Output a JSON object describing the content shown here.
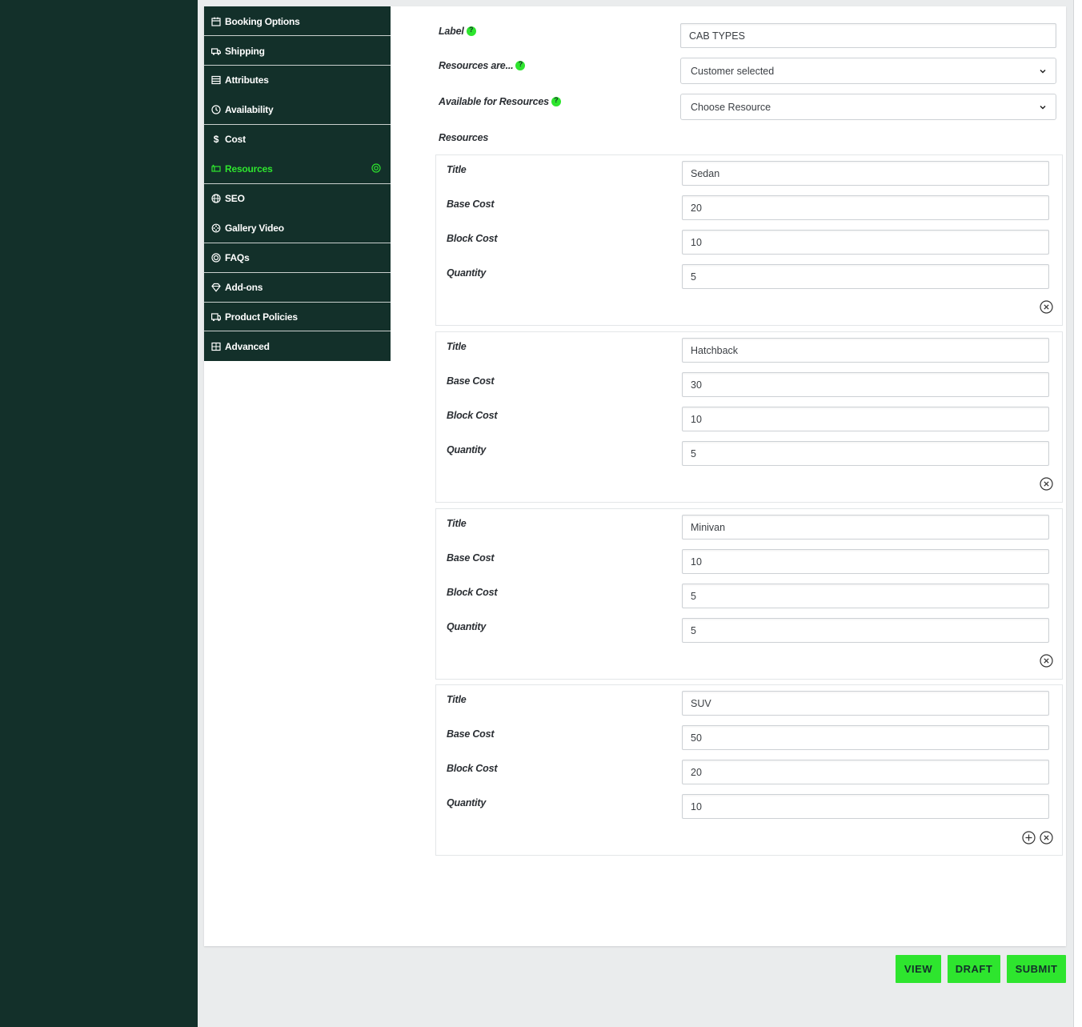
{
  "nav": {
    "items": [
      {
        "label": "Booking Options",
        "icon": "calendar-icon"
      },
      {
        "label": "Shipping",
        "icon": "truck-icon"
      },
      {
        "label": "Attributes",
        "icon": "list-icon"
      },
      {
        "label": "Availability",
        "icon": "clock-icon"
      },
      {
        "label": "Cost",
        "icon": "dollar-icon"
      },
      {
        "label": "Resources",
        "icon": "resources-icon",
        "active": true
      },
      {
        "label": "SEO",
        "icon": "globe-icon"
      },
      {
        "label": "Gallery Video",
        "icon": "film-icon"
      },
      {
        "label": "FAQs",
        "icon": "faq-icon"
      },
      {
        "label": "Add-ons",
        "icon": "diamond-icon"
      },
      {
        "label": "Product Policies",
        "icon": "policy-icon"
      },
      {
        "label": "Advanced",
        "icon": "grid-icon"
      }
    ]
  },
  "form": {
    "label_label": "Label",
    "label_value": "CAB TYPES",
    "resources_are_label": "Resources are...",
    "resources_are_value": "Customer selected",
    "available_for_label": "Available for Resources",
    "available_for_value": "Choose Resource",
    "resources_heading": "Resources"
  },
  "resource_fields": {
    "title": "Title",
    "base_cost": "Base Cost",
    "block_cost": "Block Cost",
    "quantity": "Quantity"
  },
  "resources": [
    {
      "title": "Sedan",
      "base_cost": "20",
      "block_cost": "10",
      "quantity": "5"
    },
    {
      "title": "Hatchback",
      "base_cost": "30",
      "block_cost": "10",
      "quantity": "5"
    },
    {
      "title": "Minivan",
      "base_cost": "10",
      "block_cost": "5",
      "quantity": "5"
    },
    {
      "title": "SUV",
      "base_cost": "50",
      "block_cost": "20",
      "quantity": "10"
    }
  ],
  "actions": {
    "view": "VIEW",
    "draft": "DRAFT",
    "submit": "SUBMIT"
  },
  "colors": {
    "accent": "#2ee52e",
    "sidebar": "#13302a"
  }
}
